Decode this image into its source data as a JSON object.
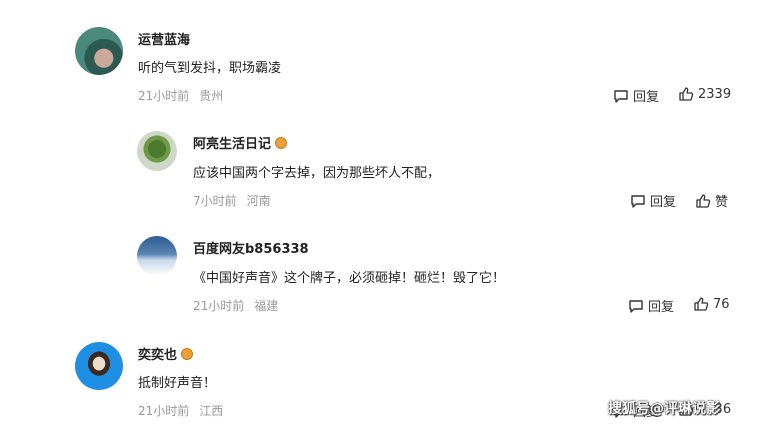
{
  "comments": [
    {
      "username": "运营蓝海",
      "badge": false,
      "text": "听的气到发抖，职场霸凌",
      "time": "21小时前",
      "location": "贵州",
      "reply_label": "回复",
      "like_label": "2339",
      "avatar_colors": [
        "#4a8a7c",
        "#2c5a52",
        "#caa89a"
      ]
    },
    {
      "username": "阿亮生活日记",
      "badge": true,
      "text": "应该中国两个字去掉，因为那些坏人不配，",
      "time": "7小时前",
      "location": "河南",
      "reply_label": "回复",
      "like_label": "赞",
      "avatar_colors": [
        "#cfd8c8",
        "#4d7a2e",
        "#7a5a3a"
      ]
    },
    {
      "username": "百度网友b856338",
      "badge": false,
      "text": "《中国好声音》这个牌子，必须砸掉！砸烂！毁了它！",
      "time": "21小时前",
      "location": "福建",
      "reply_label": "回复",
      "like_label": "76",
      "avatar_colors": [
        "#2e5c8f",
        "#c8d9ea",
        "#ffffff"
      ]
    },
    {
      "username": "奕奕也",
      "badge": true,
      "text": "抵制好声音！",
      "time": "21小时前",
      "location": "江西",
      "reply_label": "回复",
      "like_label": "2236",
      "avatar_colors": [
        "#1f8fe6",
        "#f0dcc8",
        "#3a2a20"
      ]
    }
  ],
  "watermark": "搜狐号@评琳说影"
}
